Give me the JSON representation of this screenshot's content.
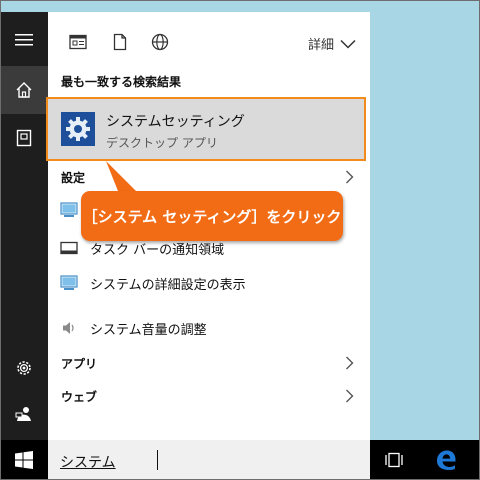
{
  "toolbar": {
    "details_label": "詳細"
  },
  "best_match": {
    "section_label": "最も一致する検索結果",
    "title": "システムセッティング",
    "subtitle": "デスクトップ アプリ"
  },
  "settings": {
    "section_label": "設定",
    "items": [
      {
        "label": ""
      },
      {
        "label": "タスク バーの通知領域"
      },
      {
        "label": "システムの詳細設定の表示"
      },
      {
        "label": "システム音量の調整"
      }
    ]
  },
  "apps": {
    "label": "アプリ"
  },
  "web": {
    "label": "ウェブ"
  },
  "callout": {
    "text": "［システム セッティング］をクリック"
  },
  "search": {
    "query": "システム"
  },
  "colors": {
    "accent_orange": "#f26c16",
    "highlight_border": "#f28b1e",
    "edge_blue": "#1e78d6",
    "rail_dark": "#1e1e1e",
    "desktop": "#a8d6e4"
  },
  "icons": [
    "hamburger-icon",
    "home-icon",
    "notebook-icon",
    "settings-gear-icon",
    "feedback-icon",
    "apps-filter-icon",
    "documents-filter-icon",
    "web-filter-icon",
    "gear-icon",
    "monitor-icon",
    "taskbar-icon",
    "speaker-icon",
    "chevron-right-icon",
    "windows-logo-icon",
    "task-view-icon",
    "edge-icon"
  ]
}
